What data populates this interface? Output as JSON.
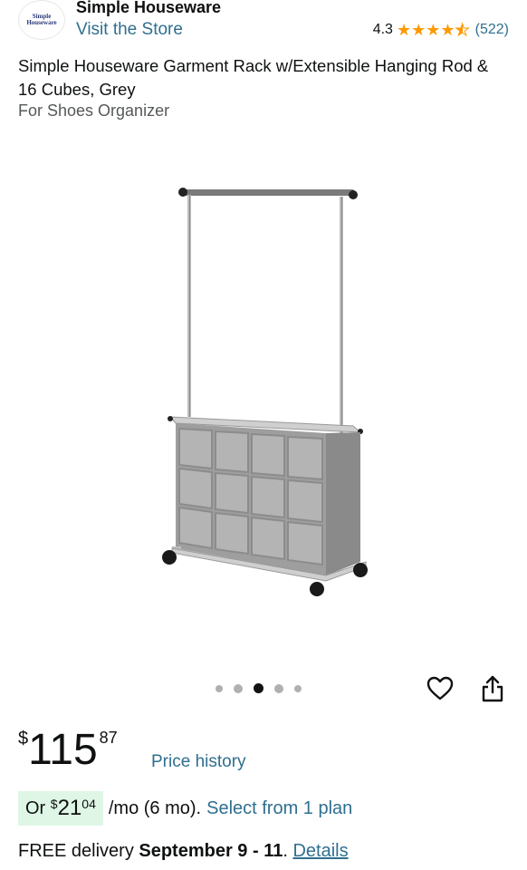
{
  "brand": {
    "logo_line1": "Simple",
    "logo_line2": "Houseware",
    "name": "Simple Houseware",
    "store_link": "Visit the Store"
  },
  "rating": {
    "value": "4.3",
    "stars": 4.3,
    "count": "(522)"
  },
  "product": {
    "title": "Simple Houseware Garment Rack w/Extensible Hanging Rod & 16 Cubes, Grey",
    "subtitle": "For Shoes Organizer"
  },
  "gallery": {
    "image_count": 5,
    "active_index": 2
  },
  "actions": {
    "wishlist_icon": "heart-icon",
    "share_icon": "share-icon"
  },
  "price": {
    "symbol": "$",
    "whole": "115",
    "fraction": "87",
    "history_link": "Price history"
  },
  "monthly": {
    "prefix": "Or",
    "symbol": "$",
    "whole": "21",
    "fraction": "04",
    "term": "/mo (6 mo).",
    "plan_link": "Select from 1 plan"
  },
  "delivery": {
    "prefix": "FREE delivery",
    "dates": "September 9 - 11",
    "separator": ".",
    "details_link": "Details"
  },
  "colors": {
    "link": "#2f6f8f",
    "star": "#ff9900",
    "monthly_highlight": "#dff6e6",
    "text": "#0f1111"
  }
}
